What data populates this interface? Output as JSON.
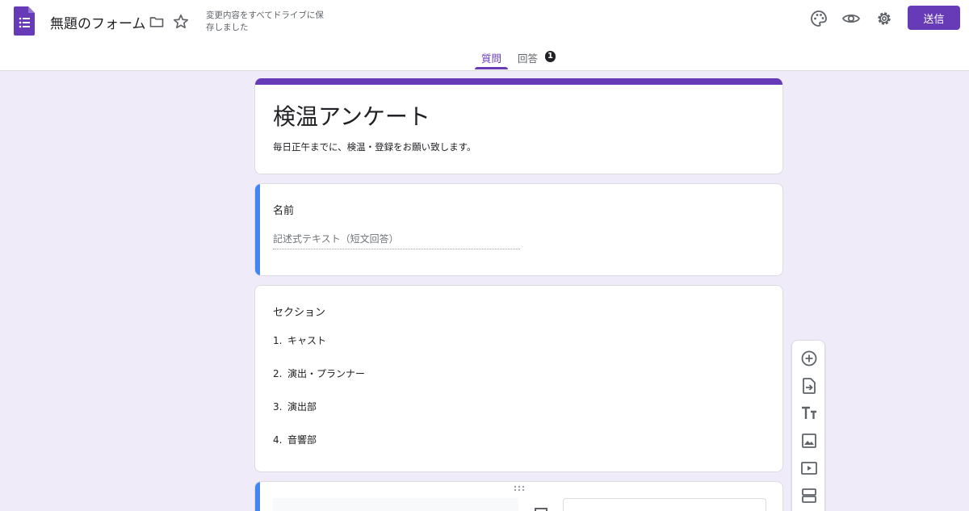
{
  "header": {
    "doc_title": "無題のフォーム",
    "save_status": "変更内容をすべてドライブに保存しました",
    "send_label": "送信"
  },
  "tabs": {
    "questions": "質問",
    "responses": "回答",
    "response_count": "1"
  },
  "form": {
    "title": "検温アンケート",
    "description": "毎日正午までに、検温・登録をお願い致します。"
  },
  "questions": [
    {
      "title": "名前",
      "placeholder": "記述式テキスト（短文回答）"
    }
  ],
  "section": {
    "title": "セクション",
    "options": [
      {
        "num": "1.",
        "label": "キャスト"
      },
      {
        "num": "2.",
        "label": "演出・プランナー"
      },
      {
        "num": "3.",
        "label": "演出部"
      },
      {
        "num": "4.",
        "label": "音響部"
      }
    ]
  },
  "colors": {
    "accent": "#673ab7",
    "background": "#f0ebf8",
    "active_question": "#4285f4"
  },
  "toolbar_icons": [
    "add-question-icon",
    "import-questions-icon",
    "add-title-icon",
    "add-image-icon",
    "add-video-icon",
    "add-section-icon"
  ]
}
